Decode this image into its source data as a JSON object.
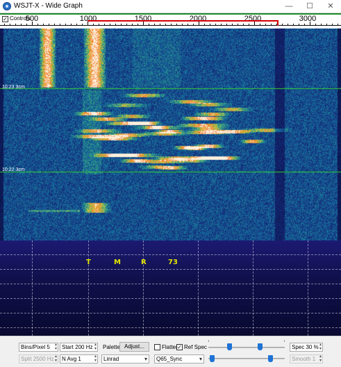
{
  "window": {
    "title": "WSJT-X - Wide Graph",
    "minimize_glyph": "—",
    "maximize_glyph": "☐",
    "close_glyph": "✕"
  },
  "scale": {
    "controls_label": "Controls",
    "controls_checked": true,
    "freq_labels": [
      "500",
      "1000",
      "1500",
      "2000",
      "2500",
      "3000"
    ]
  },
  "waterfall": {
    "timestamps": [
      {
        "text": "10:23   3cm"
      },
      {
        "text": "10:22   3cm"
      }
    ]
  },
  "spectrum": {
    "labels": [
      "T",
      "M",
      "R",
      "73"
    ],
    "label_color": "#e6e600"
  },
  "controls": {
    "bins_per_pixel": "Bins/Pixel  5",
    "start": "Start 200 Hz",
    "palette_label": "Palette",
    "adjust_button": "Adjust...",
    "flatten_label": "Flatten",
    "flatten_checked": false,
    "ref_spec_label": "Ref Spec",
    "ref_spec_checked": true,
    "spec": "Spec 30 %",
    "split": "Split  2500  Hz",
    "n_avg": "N Avg  1",
    "palette_value": "Linrad",
    "mode_value": "Q65_Sync",
    "smooth": "Smooth  1"
  },
  "colors": {
    "spectrum_bg": "#10104c",
    "slider_handle": "#1e73d6",
    "tx_marker": "#d10000"
  }
}
